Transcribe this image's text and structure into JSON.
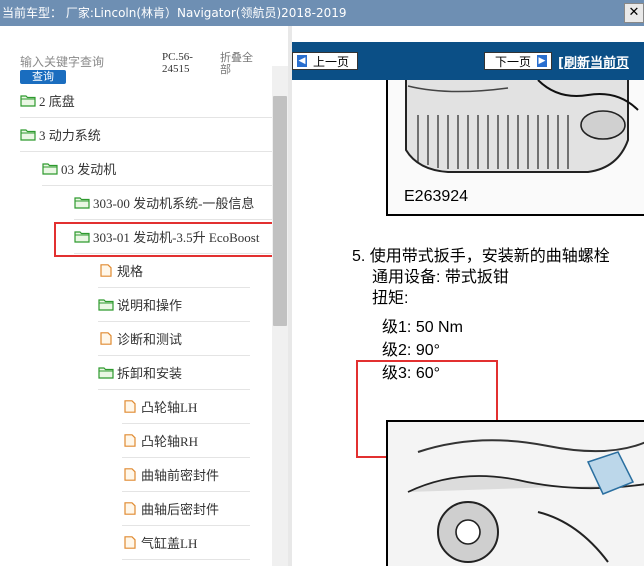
{
  "window": {
    "title": "当前车型： 厂家:Lincoln(林肯）Navigator(领航员)2018-2019",
    "close_label": "✕"
  },
  "search": {
    "placeholder": "输入关键字查询",
    "query_label": "查询",
    "pc_code": "PC.56-24515",
    "collapse_label": "折叠全部"
  },
  "tree": {
    "nodes": [
      {
        "label": "2 底盘",
        "icon": "folder-open-icon"
      },
      {
        "label": "3 动力系统",
        "icon": "folder-open-icon"
      },
      {
        "label": "03 发动机",
        "icon": "folder-open-icon"
      },
      {
        "label": "303-00 发动机系统-一般信息",
        "icon": "folder-open-icon"
      },
      {
        "label": "303-01 发动机-3.5升 EcoBoost",
        "icon": "folder-open-icon"
      },
      {
        "label": "规格",
        "icon": "document-icon"
      },
      {
        "label": "说明和操作",
        "icon": "folder-open-icon"
      },
      {
        "label": "诊断和测试",
        "icon": "document-icon"
      },
      {
        "label": "拆卸和安装",
        "icon": "folder-open-icon"
      },
      {
        "label": "凸轮轴LH",
        "icon": "document-icon"
      },
      {
        "label": "凸轮轴RH",
        "icon": "document-icon"
      },
      {
        "label": "曲轴前密封件",
        "icon": "document-icon"
      },
      {
        "label": "曲轴后密封件",
        "icon": "document-icon"
      },
      {
        "label": "气缸盖LH",
        "icon": "document-icon"
      }
    ]
  },
  "nav": {
    "prev_label": "上一页",
    "next_label": "下一页",
    "refresh_label": "[刷新当前页"
  },
  "document": {
    "figure_id": "E263924",
    "step_line1": "5. 使用带式扳手，安装新的曲轴螺栓",
    "step_line2": "通用设备: 带式扳钳",
    "step_line3": "扭矩:",
    "torque": [
      {
        "stage": "级1:",
        "value": "50 Nm"
      },
      {
        "stage": "级2:",
        "value": "90°"
      },
      {
        "stage": "级3:",
        "value": "60°"
      }
    ]
  },
  "colors": {
    "titlebar": "#6e8fb3",
    "navbar": "#0b4f86",
    "highlight": "#e23030",
    "folder": "#2e9a2e",
    "document_icon": "#e08a30"
  }
}
